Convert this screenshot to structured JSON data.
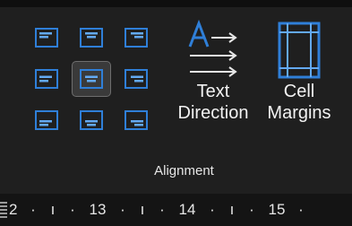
{
  "colors": {
    "icon_blue": "#2f7fd8",
    "icon_bar": "#63a9f2",
    "background": "#1f1f1f",
    "selected_bg": "#3a3a3a"
  },
  "alignment_grid": [
    {
      "name": "align-top-left",
      "selected": false
    },
    {
      "name": "align-top-center",
      "selected": false
    },
    {
      "name": "align-top-right",
      "selected": false
    },
    {
      "name": "align-center-left",
      "selected": false
    },
    {
      "name": "align-center",
      "selected": true
    },
    {
      "name": "align-center-right",
      "selected": false
    },
    {
      "name": "align-bottom-left",
      "selected": false
    },
    {
      "name": "align-bottom-center",
      "selected": false
    },
    {
      "name": "align-bottom-right",
      "selected": false
    }
  ],
  "text_direction": {
    "line1": "Text",
    "line2": "Direction",
    "icon": "text-direction-icon"
  },
  "cell_margins": {
    "line1": "Cell",
    "line2": "Margins",
    "icon": "cell-margins-icon"
  },
  "group_label": "Alignment",
  "ruler": {
    "labels": [
      "2",
      "·",
      "ı",
      "·",
      "13",
      "·",
      "ı",
      "·",
      "14",
      "·",
      "ı",
      "·",
      "15",
      "·"
    ]
  }
}
